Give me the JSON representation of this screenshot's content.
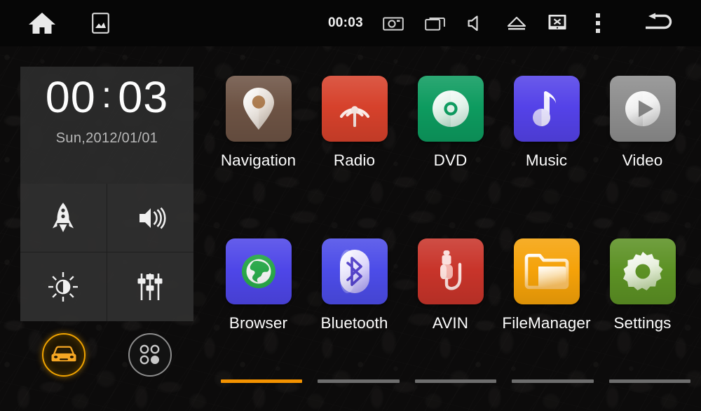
{
  "statusbar": {
    "time": "00:03",
    "left_icons": [
      {
        "name": "home-icon",
        "label": "Home"
      },
      {
        "name": "wallpaper-icon",
        "label": "Wallpaper"
      }
    ],
    "right_icons": [
      {
        "name": "screenshot-icon",
        "label": "Screenshot"
      },
      {
        "name": "recents-icon",
        "label": "Recent apps"
      },
      {
        "name": "mute-icon",
        "label": "Mute"
      },
      {
        "name": "eject-icon",
        "label": "Eject"
      },
      {
        "name": "screen-off-icon",
        "label": "Screen off"
      },
      {
        "name": "overflow-menu-icon",
        "label": "More"
      },
      {
        "name": "back-icon",
        "label": "Back"
      }
    ]
  },
  "clock_widget": {
    "hours": "00",
    "separator": ":",
    "minutes": "03",
    "date": "Sun,2012/01/01"
  },
  "quick_toggles": [
    {
      "name": "boost-toggle",
      "icon": "rocket-icon",
      "label": "Boost"
    },
    {
      "name": "volume-toggle",
      "icon": "volume-icon",
      "label": "Volume"
    },
    {
      "name": "brightness-toggle",
      "icon": "brightness-icon",
      "label": "Brightness"
    },
    {
      "name": "equalizer-toggle",
      "icon": "equalizer-icon",
      "label": "Equalizer"
    }
  ],
  "circle_buttons": [
    {
      "name": "car-button",
      "icon": "car-icon",
      "label": "Car",
      "active": true,
      "color": "#f5a623"
    },
    {
      "name": "apps-button",
      "icon": "apps-grid-icon",
      "label": "Apps",
      "active": false,
      "color": "#8d8d8d"
    }
  ],
  "apps": {
    "row1": [
      {
        "label": "Navigation",
        "icon": "map-pin-icon",
        "color": "#6d5344"
      },
      {
        "label": "Radio",
        "icon": "radio-waves-icon",
        "color": "#d6412b"
      },
      {
        "label": "DVD",
        "icon": "disc-icon",
        "color": "#0d9b5f"
      },
      {
        "label": "Music",
        "icon": "music-note-icon",
        "color": "#5442e8"
      },
      {
        "label": "Video",
        "icon": "play-circle-icon",
        "color": "#8d8d8d"
      }
    ],
    "row2": [
      {
        "label": "Browser",
        "icon": "globe-icon",
        "color": "#4e46e8"
      },
      {
        "label": "Bluetooth",
        "icon": "bluetooth-icon",
        "color": "#4c4ce8"
      },
      {
        "label": "AVIN",
        "icon": "av-plug-icon",
        "color": "#c8342a"
      },
      {
        "label": "FileManager",
        "icon": "folder-icon",
        "color": "#f5a209"
      },
      {
        "label": "Settings",
        "icon": "gear-icon",
        "color": "#5c9124"
      }
    ]
  },
  "page_indicator": {
    "count": 5,
    "active_index": 0,
    "active_color": "#f39200",
    "inactive_color": "#6d6d6d"
  }
}
